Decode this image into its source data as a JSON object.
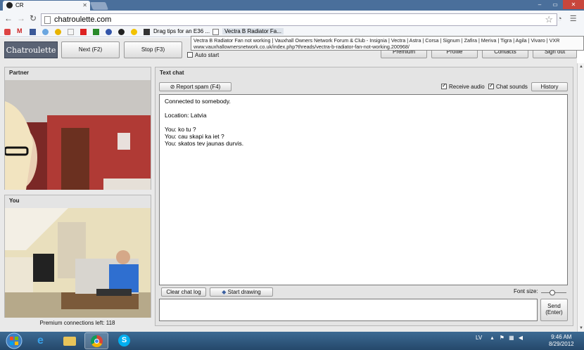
{
  "browser": {
    "tab_title": "CR",
    "address": "chatroulette.com",
    "bookmarks": [
      "Drag tips for an E36 ...",
      "Vectra B Radiator Fa..."
    ],
    "tooltip_line1": "Vectra B Radiator Fan not working | Vauxhall Owners Network Forum & Club - Insignia | Vectra | Astra | Corsa | Signum | Zafira | Meriva | Tigra | Agila | Vivaro | VXR",
    "tooltip_line2": "www.vauxhallownersnetwork.co.uk/index.php?threads/vectra-b-radiator-fan-not-working.200968/"
  },
  "app": {
    "logo": "Chatroulette",
    "next_button": "Next (F2)",
    "stop_button": "Stop (F3)",
    "autostart_label": "Auto start",
    "top_menu": [
      "Premium",
      "Profile",
      "Contacts",
      "Sign out"
    ]
  },
  "partner": {
    "title": "Partner"
  },
  "you": {
    "title": "You"
  },
  "premium_text": "Premium connections left: 118",
  "chat": {
    "title": "Text chat",
    "report_spam": "Report spam (F4)",
    "receive_audio": "Receive audio",
    "chat_sounds": "Chat sounds",
    "history": "History",
    "messages": [
      "Connected to somebody.",
      "",
      "Location: Latvia",
      "",
      "You: ko tu ?",
      "You: cau skapi ka iet ?",
      "You: skatos tev jaunas durvis."
    ],
    "clear_log": "Clear chat log",
    "start_drawing": "Start drawing",
    "font_size_label": "Font size:",
    "send_line1": "Send",
    "send_line2": "(Enter)"
  },
  "taskbar": {
    "language": "LV",
    "time": "9:46 AM",
    "date": "8/29/2012"
  },
  "colors": {
    "titlebar": "#4a6f9b",
    "logo_bg": "#5a6374",
    "taskbar": "#2f5880"
  }
}
